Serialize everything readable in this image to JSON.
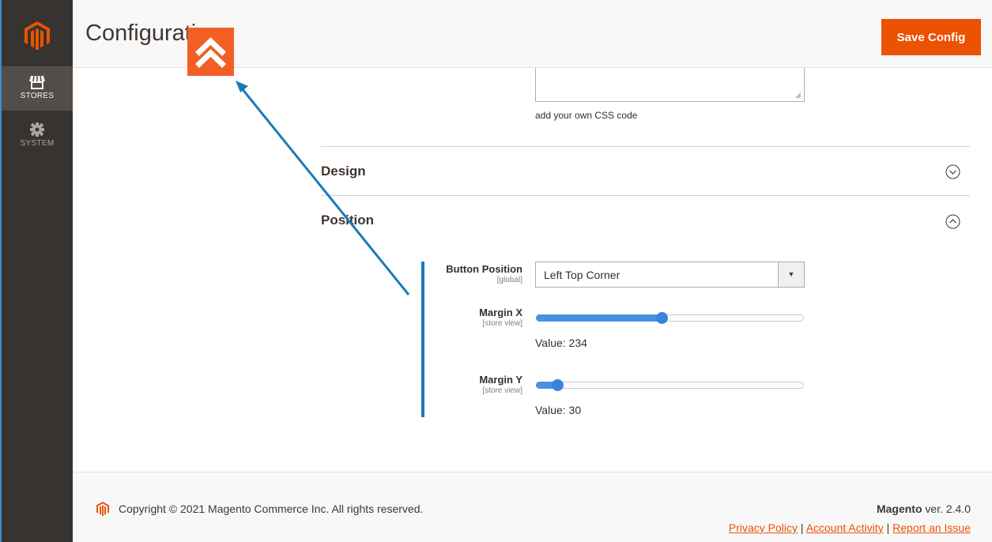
{
  "header": {
    "title": "Configurati",
    "save_label": "Save Config"
  },
  "sidebar": {
    "items": [
      {
        "label": "STORES",
        "icon": "store-icon",
        "active": true
      },
      {
        "label": "SYSTEM",
        "icon": "gear-icon",
        "active": false
      }
    ]
  },
  "content": {
    "textarea_note": "add your own CSS code",
    "sections": [
      {
        "title": "Design",
        "state": "collapsed"
      },
      {
        "title": "Position",
        "state": "expanded"
      }
    ],
    "fields": {
      "button_position": {
        "label": "Button Position",
        "scope": "[global]",
        "value": "Left Top Corner"
      },
      "margin_x": {
        "label": "Margin X",
        "scope": "[store view]",
        "value_text": "Value: 234",
        "value": 234,
        "fill_fraction": 0.47
      },
      "margin_y": {
        "label": "Margin Y",
        "scope": "[store view]",
        "value_text": "Value: 30",
        "value": 30,
        "fill_fraction": 0.08
      }
    }
  },
  "footer": {
    "copyright": "Copyright © 2021 Magento Commerce Inc. All rights reserved.",
    "brand": "Magento",
    "version": " ver. 2.4.0",
    "links": [
      "Privacy Policy",
      " Account Activity",
      "Report an Issue"
    ],
    "separator": " | "
  },
  "colors": {
    "accent": "#eb5202",
    "sidebar": "#373330",
    "link_blue": "#1979c3",
    "slider": "#4a90e2"
  }
}
